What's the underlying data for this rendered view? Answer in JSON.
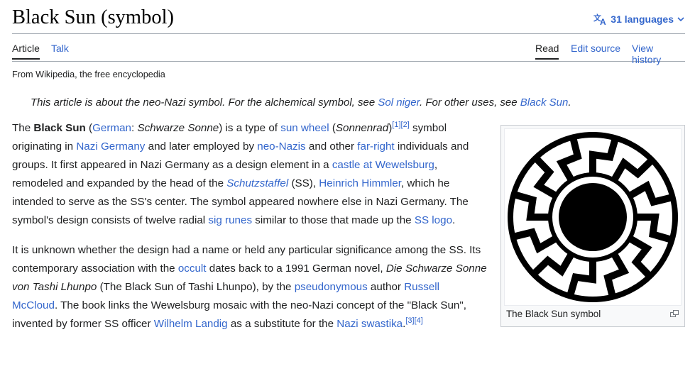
{
  "page": {
    "title": "Black Sun (symbol)",
    "languages_label": "31 languages",
    "from": "From Wikipedia, the free encyclopedia"
  },
  "tabs": {
    "article": "Article",
    "talk": "Talk",
    "read": "Read",
    "edit_source": "Edit source",
    "view_history": "View history"
  },
  "hatnote": {
    "t1": "This article is about the neo-Nazi symbol. For the alchemical symbol, see ",
    "l1": "Sol niger",
    "t2": ". For other uses, see ",
    "l2": "Black Sun",
    "t3": "."
  },
  "p1": {
    "t1": "The ",
    "b1": "Black Sun",
    "t2": " (",
    "l1": "German",
    "t3": ": ",
    "i1": "Schwarze Sonne",
    "t4": ") is a type of ",
    "l2": "sun wheel",
    "t5": " (",
    "i2": "Sonnenrad",
    "t6": ")",
    "s1": "[1]",
    "s2": "[2]",
    "t7": " symbol originating in ",
    "l3": "Nazi Germany",
    "t8": " and later employed by ",
    "l4": "neo-Nazis",
    "t9": " and other ",
    "l5": "far-right",
    "t10": " individuals and groups. It first appeared in Nazi Germany as a design element in a ",
    "l6": "castle at Wewelsburg",
    "t11": ", remodeled and expanded by the head of the ",
    "l7": "Schutzstaffel",
    "t12": " (SS), ",
    "l8": "Heinrich Himmler",
    "t13": ", which he intended to serve as the SS's center. The symbol appeared nowhere else in Nazi Germany. The symbol's design consists of twelve radial ",
    "l9": "sig runes",
    "t14": " similar to those that made up the ",
    "l10": "SS logo",
    "t15": "."
  },
  "p2": {
    "t1": "It is unknown whether the design had a name or held any particular significance among the SS. Its contemporary association with the ",
    "l1": "occult",
    "t2": " dates back to a 1991 German novel, ",
    "i1": "Die Schwarze Sonne von Tashi Lhunpo",
    "t3": " (The Black Sun of Tashi Lhunpo), by the ",
    "l2": "pseudonymous",
    "t4": " author ",
    "l3": "Russell McCloud",
    "t5": ". The book links the Wewelsburg mosaic with the neo-Nazi concept of the \"Black Sun\", invented by former SS officer ",
    "l4": "Wilhelm Landig",
    "t6": " as a substitute for the ",
    "l5": "Nazi swastika",
    "t7": ".",
    "s1": "[3]",
    "s2": "[4]"
  },
  "infobox": {
    "caption": "The Black Sun symbol",
    "image_icon": "black-sun-symbol-icon",
    "enlarge_icon": "enlarge-icon"
  },
  "colors": {
    "link": "#3366cc",
    "text": "#202122",
    "border": "#a2a9b1"
  }
}
